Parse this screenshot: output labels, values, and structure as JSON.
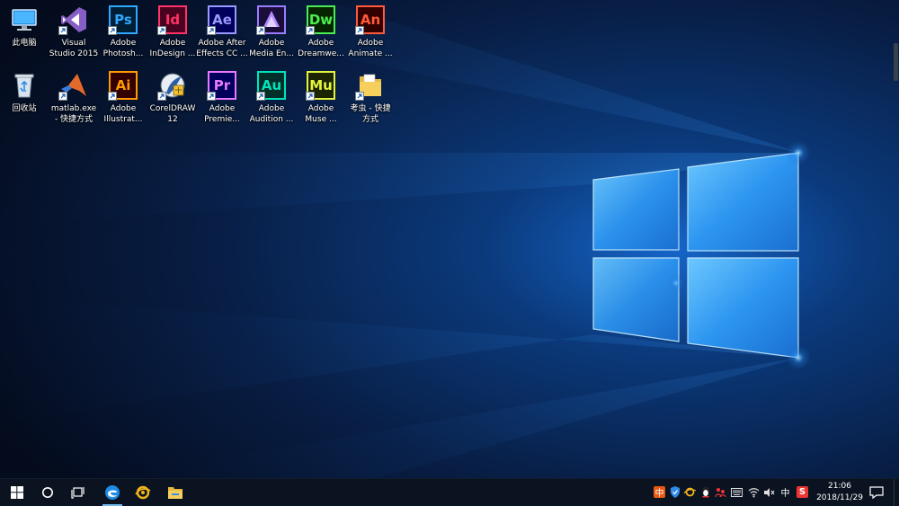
{
  "desktop": {
    "icons": [
      {
        "label": "此电脑",
        "icon": "this-pc-icon"
      },
      {
        "label": "Visual\nStudio 2015",
        "icon": "visual-studio-icon"
      },
      {
        "label": "Adobe\nPhotosh...",
        "icon": "photoshop-icon",
        "abbr": "Ps",
        "color": "#31a8ff",
        "bg": "#001e36"
      },
      {
        "label": "Adobe\nInDesign ...",
        "icon": "indesign-icon",
        "abbr": "Id",
        "color": "#ff3366",
        "bg": "#49021f"
      },
      {
        "label": "Adobe After\nEffects CC ...",
        "icon": "after-effects-icon",
        "abbr": "Ae",
        "color": "#9999ff",
        "bg": "#00005b"
      },
      {
        "label": "Adobe\nMedia En...",
        "icon": "media-encoder-icon"
      },
      {
        "label": "Adobe\nDreamwe...",
        "icon": "dreamweaver-icon",
        "abbr": "Dw",
        "color": "#4bee52",
        "bg": "#072401"
      },
      {
        "label": "Adobe\nAnimate ...",
        "icon": "animate-icon",
        "abbr": "An",
        "color": "#ff5a3a",
        "bg": "#330000"
      },
      {
        "label": "回收站",
        "icon": "recycle-bin-icon"
      },
      {
        "label": "matlab.exe\n- 快捷方式",
        "icon": "matlab-icon"
      },
      {
        "label": "Adobe\nIllustrat...",
        "icon": "illustrator-icon",
        "abbr": "Ai",
        "color": "#ff9a00",
        "bg": "#330000"
      },
      {
        "label": "CorelDRAW\n12",
        "icon": "coreldraw-icon"
      },
      {
        "label": "Adobe\nPremie...",
        "icon": "premiere-icon",
        "abbr": "Pr",
        "color": "#ea77ff",
        "bg": "#00005b"
      },
      {
        "label": "Adobe\nAudition ...",
        "icon": "audition-icon",
        "abbr": "Au",
        "color": "#00e4bb",
        "bg": "#002e28"
      },
      {
        "label": "Adobe\nMuse ...",
        "icon": "muse-icon",
        "abbr": "Mu",
        "color": "#e2f43d",
        "bg": "#1c2400"
      },
      {
        "label": "考虫 - 快捷\n方式",
        "icon": "folder-shortcut-icon"
      }
    ]
  },
  "taskbar": {
    "start": "windows-start-icon",
    "search": "cortana-circle-icon",
    "task_view": "task-view-icon",
    "pinned": [
      "edge-browser-icon",
      "browser-swirl-icon",
      "file-explorer-icon"
    ]
  },
  "tray": {
    "ime_mode": "中",
    "ime_lang": "中",
    "sogou": "S",
    "volume": "🔇",
    "time": "21:06",
    "date": "2018/11/29"
  },
  "colors": {
    "wallpaper_glow": "#2b8ef0",
    "taskbar": "#0b1321",
    "accent": "#76b9ed"
  }
}
